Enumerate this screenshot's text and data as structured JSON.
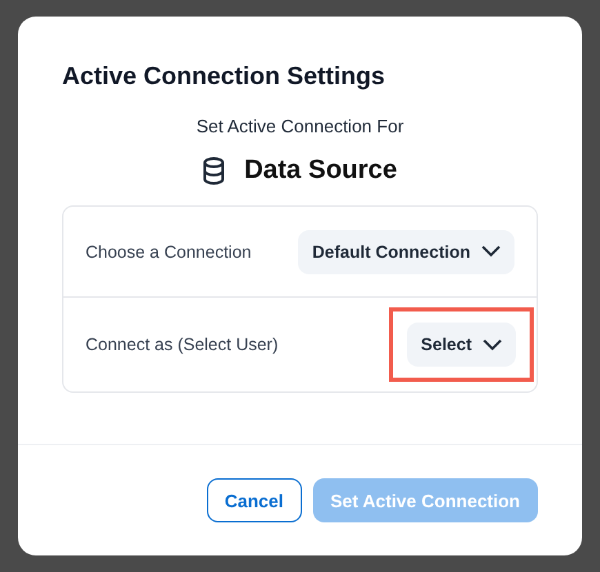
{
  "dialog": {
    "title": "Active Connection Settings",
    "subtitle": "Set Active Connection For",
    "source_name": "Data Source"
  },
  "rows": [
    {
      "label": "Choose a Connection",
      "value": "Default Connection",
      "highlighted": false
    },
    {
      "label": "Connect as (Select User)",
      "value": "Select",
      "highlighted": true
    }
  ],
  "buttons": [
    {
      "label": "Cancel",
      "kind": "secondary",
      "disabled": false
    },
    {
      "label": "Set Active Connection",
      "kind": "primary",
      "disabled": true
    }
  ]
}
